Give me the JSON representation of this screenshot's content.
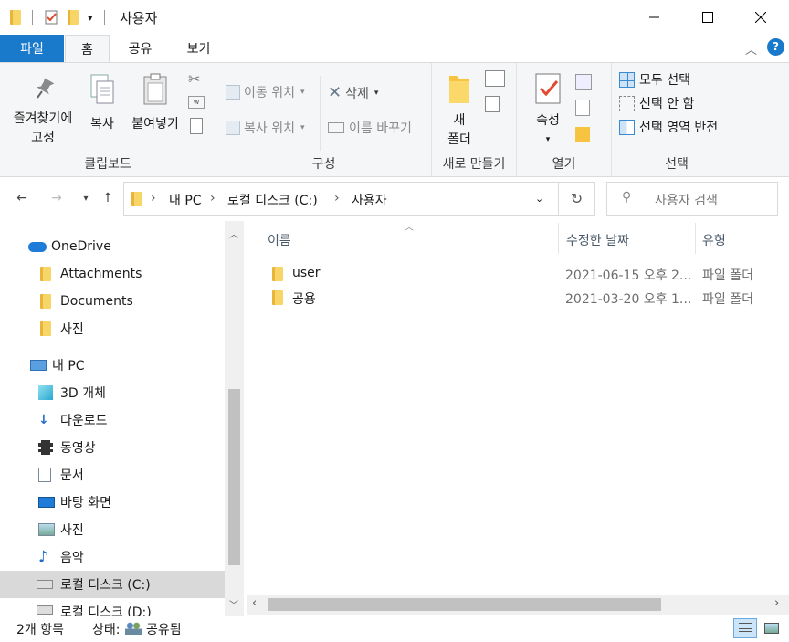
{
  "window": {
    "title": "사용자"
  },
  "ribbon_tabs": [
    "파일",
    "홈",
    "공유",
    "보기"
  ],
  "clipboard": {
    "pin": "즐겨찾기에\n고정",
    "copy": "복사",
    "paste": "붙여넣기",
    "label": "클립보드"
  },
  "organize": {
    "move_to": "이동 위치",
    "copy_to": "복사 위치",
    "delete": "삭제",
    "rename": "이름 바꾸기",
    "label": "구성"
  },
  "new": {
    "new_folder": "새\n폴더",
    "label": "새로 만들기"
  },
  "open": {
    "properties": "속성",
    "label": "열기"
  },
  "select": {
    "select_all": "모두 선택",
    "select_none": "선택 안 함",
    "invert": "선택 영역 반전",
    "label": "선택"
  },
  "address": {
    "crumbs": [
      "내 PC",
      "로컬 디스크 (C:)",
      "사용자"
    ],
    "search_placeholder": "사용자 검색"
  },
  "nav": {
    "items": [
      {
        "label": "OneDrive",
        "icon": "cloud-icon"
      },
      {
        "label": "Attachments",
        "icon": "folder-icon"
      },
      {
        "label": "Documents",
        "icon": "folder-icon"
      },
      {
        "label": "사진",
        "icon": "folder-icon"
      },
      {
        "label": "내 PC",
        "icon": "pc-icon"
      },
      {
        "label": "3D 개체",
        "icon": "cube-icon"
      },
      {
        "label": "다운로드",
        "icon": "download-icon"
      },
      {
        "label": "동영상",
        "icon": "film-icon"
      },
      {
        "label": "문서",
        "icon": "document-icon"
      },
      {
        "label": "바탕 화면",
        "icon": "desktop-icon"
      },
      {
        "label": "사진",
        "icon": "picture-icon"
      },
      {
        "label": "음악",
        "icon": "music-icon"
      },
      {
        "label": "로컬 디스크 (C:)",
        "icon": "drive-icon"
      },
      {
        "label": "로컬 디스크 (D:)",
        "icon": "drive-icon"
      }
    ]
  },
  "columns": [
    "이름",
    "수정한 날짜",
    "유형"
  ],
  "files": [
    {
      "name": "user",
      "date": "2021-06-15 오후 2...",
      "type": "파일 폴더"
    },
    {
      "name": "공용",
      "date": "2021-03-20 오후 1...",
      "type": "파일 폴더"
    }
  ],
  "status": {
    "count": "2개 항목",
    "state_label": "상태:",
    "state": "공유됨"
  }
}
